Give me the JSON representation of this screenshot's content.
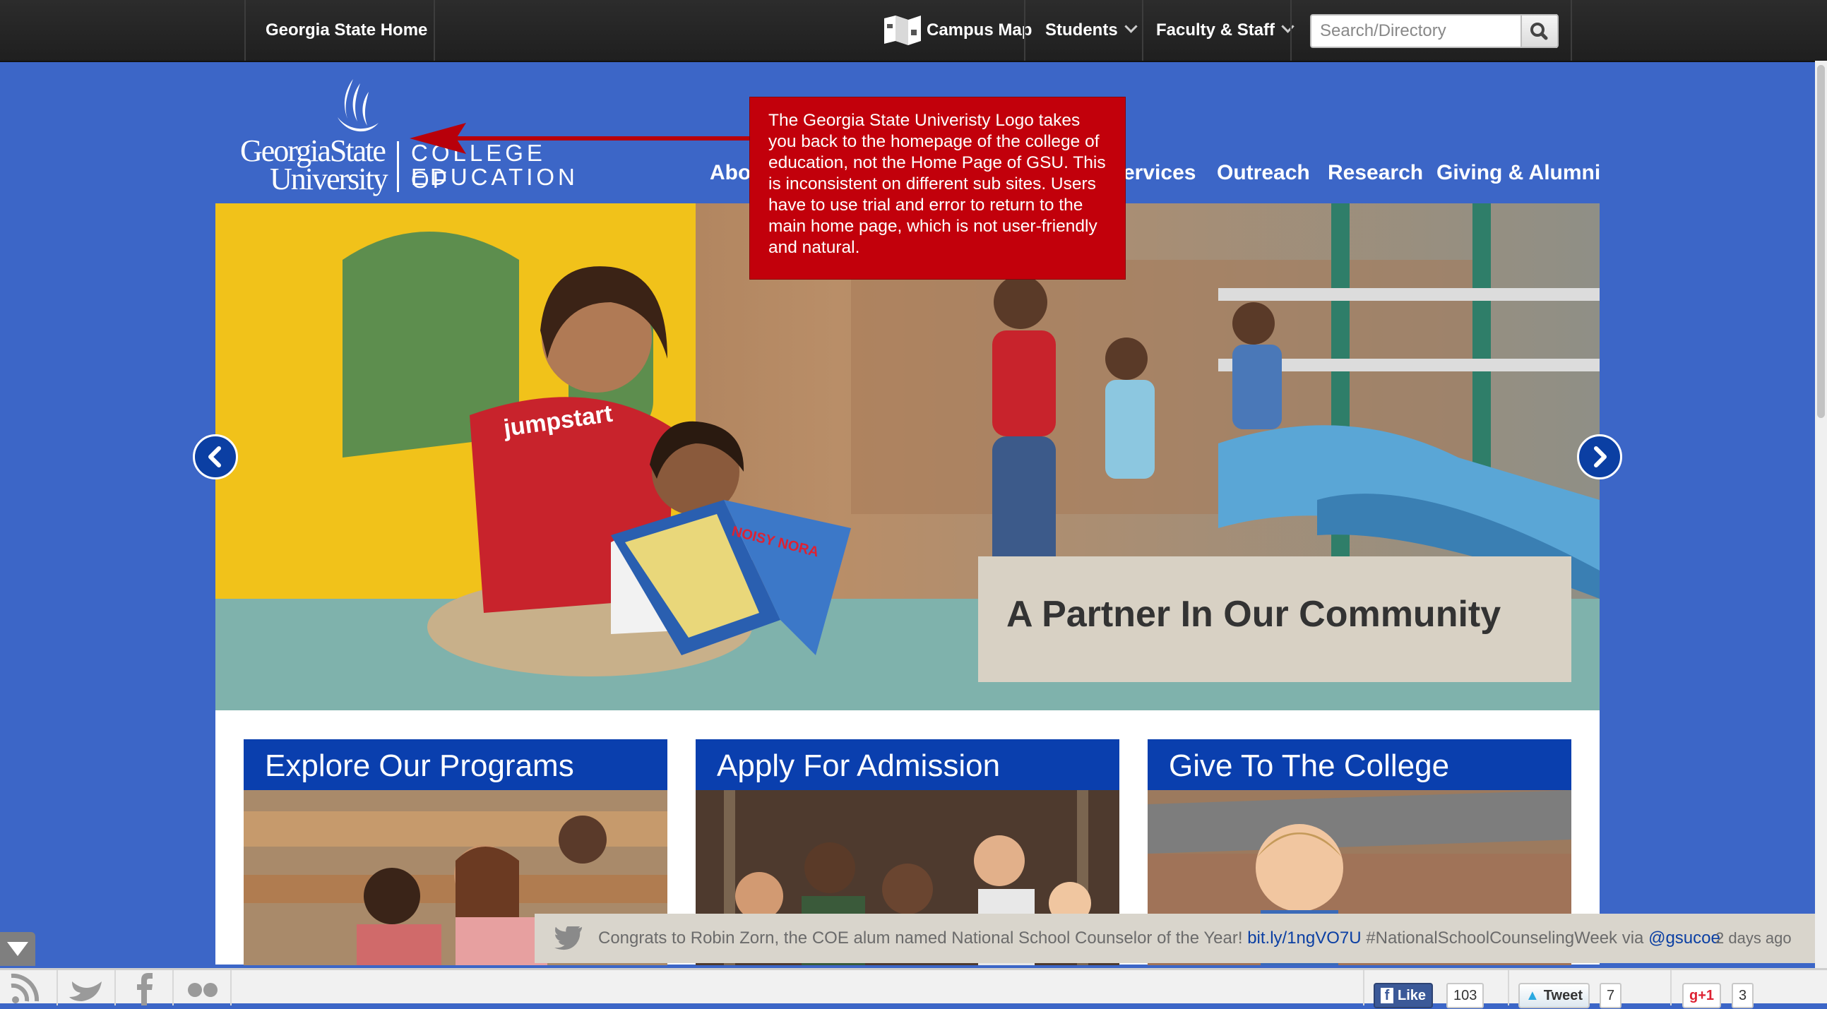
{
  "topbar": {
    "home_label": "Georgia State Home",
    "campus_map_label": "Campus Map",
    "students_label": "Students",
    "faculty_label": "Faculty & Staff",
    "search_placeholder": "Search/Directory"
  },
  "logo": {
    "line1": "GeorgiaState",
    "line2": "University",
    "college_line1": "COLLEGE OF",
    "college_line2": "EDUCATION"
  },
  "nav": {
    "items": [
      "Abo",
      "ervices",
      "Outreach",
      "Research",
      "Giving & Alumni"
    ]
  },
  "hero": {
    "caption": "A Partner In Our Community",
    "shirt_text": "jumpstart",
    "book_title": "NOISY NORA"
  },
  "cards": [
    {
      "title": "Explore Our Programs"
    },
    {
      "title": "Apply For Admission"
    },
    {
      "title": "Give To The College"
    }
  ],
  "annotation": {
    "text": "The Georgia State Univeristy Logo takes you back to the homepage of the college of education, not the Home Page of GSU. This is inconsistent on different sub sites. Users have to use trial and error to return to the main home page, which is not user-friendly and natural."
  },
  "tweet": {
    "text_before": "Congrats to Robin Zorn, the COE alum named National School Counselor of the Year! ",
    "link": "bit.ly/1ngVO7U",
    "hashtag": " #NationalSchoolCounselingWeek via ",
    "handle": "@gsucoe",
    "time": "2 days ago"
  },
  "social": {
    "like_label": "Like",
    "like_count": "103",
    "tweet_label": "Tweet",
    "tweet_count": "7",
    "gplus_label": "+1",
    "gplus_count": "3"
  },
  "colors": {
    "page_bg": "#3c66c7",
    "card_head": "#0a3fae",
    "annotation_bg": "#c2000b",
    "arrow": "#b8000a"
  }
}
